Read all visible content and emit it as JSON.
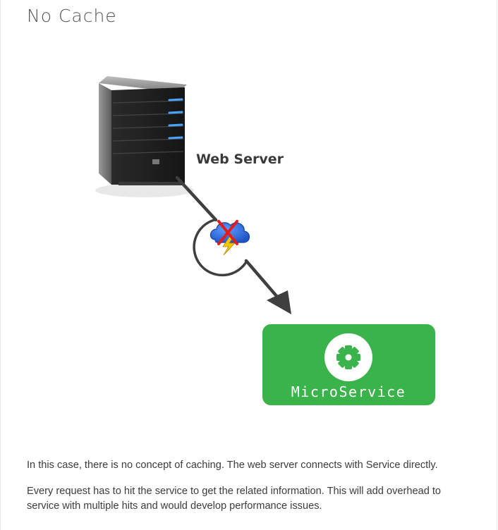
{
  "page": {
    "title": "No Cache"
  },
  "diagram": {
    "server_label": "Web Server",
    "service_label": "MicroService",
    "colors": {
      "service_box": "#3ab34a",
      "arrow": "#3f3f3f",
      "cloud": "#2e6fd8",
      "bolt": "#f5c600",
      "cross": "#e31b1b",
      "server_stripe": "#4aa3ff"
    },
    "icons": [
      "server-icon",
      "no-cache-cloud-icon",
      "gear-icon"
    ]
  },
  "body": {
    "paragraph1": "In this case, there is no concept of caching. The web server connects with Service directly.",
    "paragraph2": "Every request has to hit the service to get the related information. This will add overhead to service with multiple hits and would develop performance issues."
  }
}
